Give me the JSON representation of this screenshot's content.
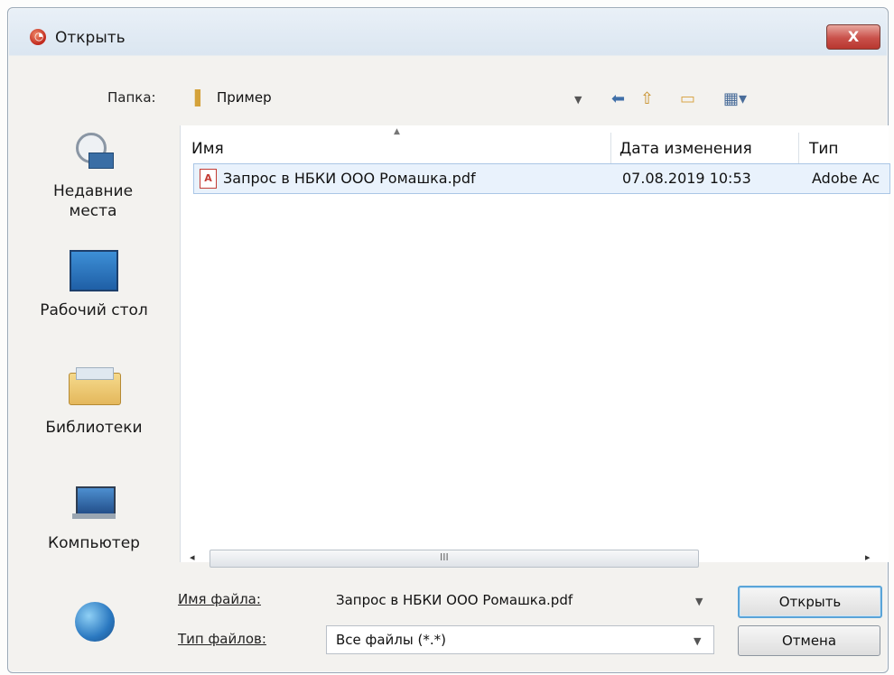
{
  "window": {
    "title": "Открыть",
    "close_label": "X"
  },
  "toolbar": {
    "folder_label": "Папка:",
    "folder_value": "Пример",
    "back_icon": "back-arrow-icon",
    "up_icon": "up-folder-icon",
    "new_folder_icon": "new-folder-icon",
    "views_icon": "view-menu-icon"
  },
  "sidebar": {
    "items": [
      {
        "label": "Недавние места",
        "icon": "recent-places-icon"
      },
      {
        "label": "Рабочий стол",
        "icon": "desktop-icon"
      },
      {
        "label": "Библиотеки",
        "icon": "libraries-icon"
      },
      {
        "label": "Компьютер",
        "icon": "computer-icon"
      },
      {
        "label": "",
        "icon": "network-icon"
      }
    ]
  },
  "file_list": {
    "columns": [
      "Имя",
      "Дата изменения",
      "Тип"
    ],
    "rows": [
      {
        "name": "Запрос в НБКИ ООО Ромашка.pdf",
        "modified": "07.08.2019 10:53",
        "type": "Adobe Ac"
      }
    ],
    "scroll_grip": "III"
  },
  "bottom": {
    "filename_label": "Имя файла:",
    "filename_value": "Запрос в НБКИ ООО Ромашка.pdf",
    "filetype_label": "Тип файлов:",
    "filetype_value": "Все файлы (*.*)",
    "open_button": "Открыть",
    "cancel_button": "Отмена"
  }
}
